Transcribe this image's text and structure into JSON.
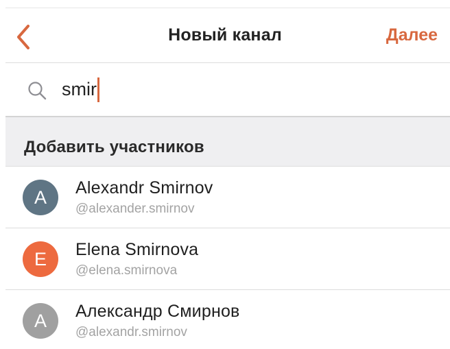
{
  "navbar": {
    "title": "Новый канал",
    "next_label": "Далее",
    "back_icon": "chevron-left-icon"
  },
  "search": {
    "icon": "search-icon",
    "value": "smir"
  },
  "section": {
    "title": "Добавить участников"
  },
  "users": [
    {
      "initial": "A",
      "name": "Alexandr Smirnov",
      "handle": "@alexander.smirnov",
      "avatar_color": "#5f7584"
    },
    {
      "initial": "E",
      "name": "Elena Smirnova",
      "handle": "@elena.smirnova",
      "avatar_color": "#ed6a3f"
    },
    {
      "initial": "A",
      "name": "Александр Смирнов",
      "handle": "@alexandr.smirnov",
      "avatar_color": "#a0a0a0"
    }
  ],
  "colors": {
    "accent": "#d8683f",
    "section_bg": "#efeff1"
  }
}
